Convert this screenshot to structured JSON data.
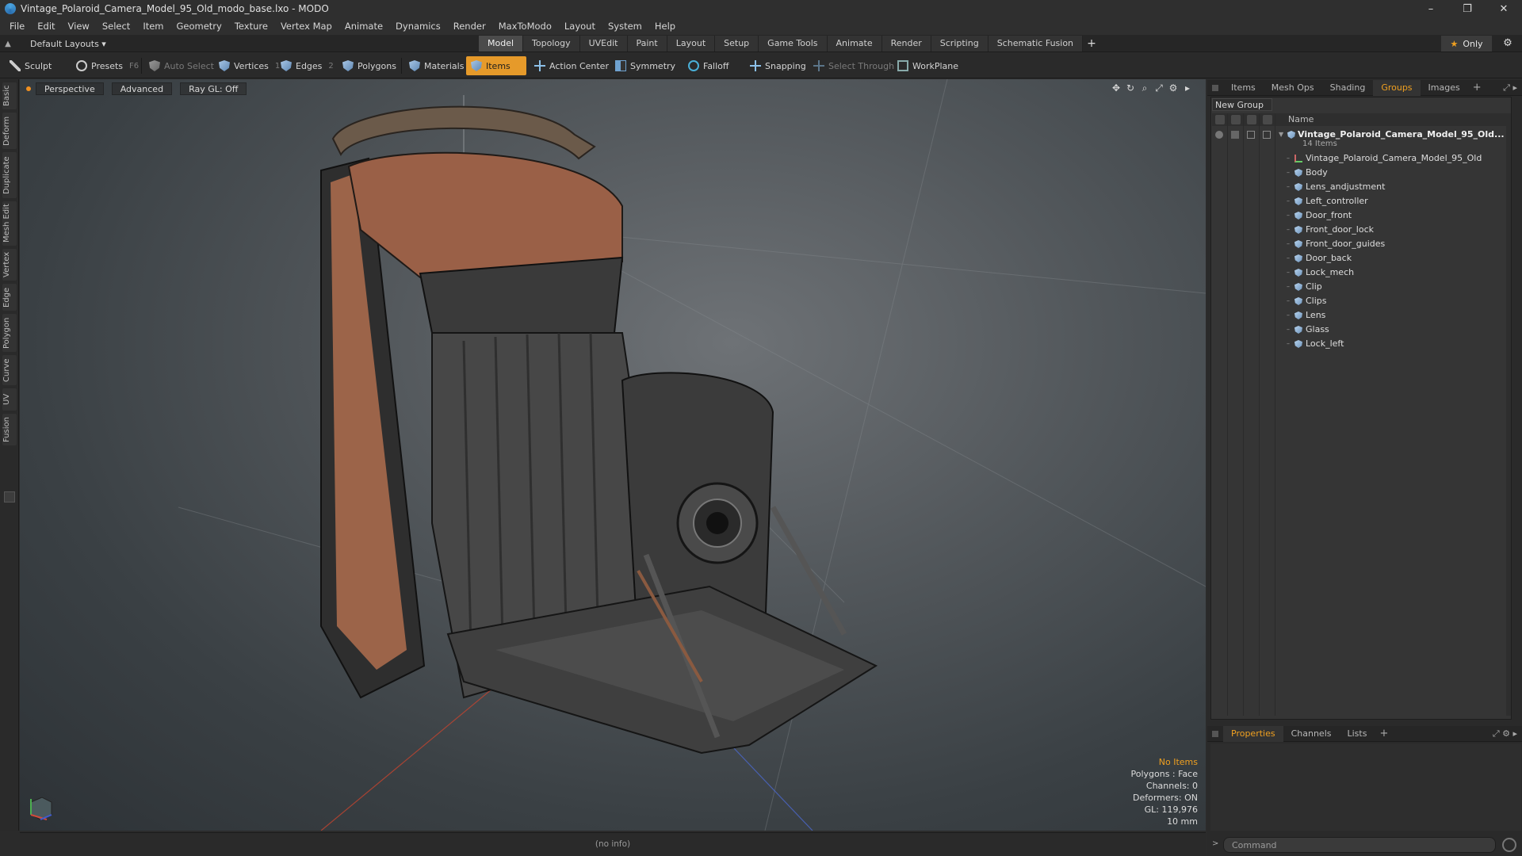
{
  "window": {
    "title": "Vintage_Polaroid_Camera_Model_95_Old_modo_base.lxo - MODO",
    "controls": [
      "–",
      "❐",
      "✕"
    ]
  },
  "menu": [
    "File",
    "Edit",
    "View",
    "Select",
    "Item",
    "Geometry",
    "Texture",
    "Vertex Map",
    "Animate",
    "Dynamics",
    "Render",
    "MaxToModo",
    "Layout",
    "System",
    "Help"
  ],
  "layout": {
    "current": "Default Layouts ▾",
    "tabs": [
      "Model",
      "Topology",
      "UVEdit",
      "Paint",
      "Layout",
      "Setup",
      "Game Tools",
      "Animate",
      "Render",
      "Scripting",
      "Schematic Fusion"
    ],
    "active_tab": "Model",
    "only_label": "Only"
  },
  "toolbar": {
    "sculpt": "Sculpt",
    "presets": "Presets",
    "presets_key": "F6",
    "auto_select": "Auto Select",
    "vertices": "Vertices",
    "vertices_key": "1",
    "edges": "Edges",
    "edges_key": "2",
    "polygons": "Polygons",
    "materials": "Materials",
    "items": "Items",
    "action_center": "Action Center",
    "symmetry": "Symmetry",
    "falloff": "Falloff",
    "snapping": "Snapping",
    "select_through": "Select Through",
    "workplane": "WorkPlane"
  },
  "left_tabs": [
    "Basic",
    "Deform",
    "Duplicate",
    "Mesh Edit",
    "Vertex",
    "Edge",
    "Polygon",
    "Curve",
    "UV",
    "Fusion"
  ],
  "viewport": {
    "perspective": "Perspective",
    "advanced": "Advanced",
    "raygl": "Ray GL: Off",
    "info": {
      "no_items": "No Items",
      "polygons": "Polygons : Face",
      "channels": "Channels: 0",
      "deformers": "Deformers: ON",
      "gl": "GL: 119,976",
      "scale": "10 mm"
    }
  },
  "status": {
    "info": "(no info)"
  },
  "panel_top": {
    "tabs": [
      "Items",
      "Mesh Ops",
      "Shading",
      "Groups",
      "Images"
    ],
    "active": "Groups",
    "new_group": "New Group",
    "col_name": "Name",
    "root": {
      "name": "Vintage_Polaroid_Camera_Model_95_Old...",
      "count": "14 Items"
    },
    "children": [
      {
        "name": "Vintage_Polaroid_Camera_Model_95_Old",
        "type": "locator"
      },
      {
        "name": "Body",
        "type": "mesh"
      },
      {
        "name": "Lens_andjustment",
        "type": "mesh"
      },
      {
        "name": "Left_controller",
        "type": "mesh"
      },
      {
        "name": "Door_front",
        "type": "mesh"
      },
      {
        "name": "Front_door_lock",
        "type": "mesh"
      },
      {
        "name": "Front_door_guides",
        "type": "mesh"
      },
      {
        "name": "Door_back",
        "type": "mesh"
      },
      {
        "name": "Lock_mech",
        "type": "mesh"
      },
      {
        "name": "Clip",
        "type": "mesh"
      },
      {
        "name": "Clips",
        "type": "mesh"
      },
      {
        "name": "Lens",
        "type": "mesh"
      },
      {
        "name": "Glass",
        "type": "mesh"
      },
      {
        "name": "Lock_left",
        "type": "mesh"
      }
    ]
  },
  "panel_bottom": {
    "tabs": [
      "Properties",
      "Channels",
      "Lists"
    ],
    "active": "Properties"
  },
  "command": {
    "prompt": ">",
    "placeholder": "Command"
  },
  "colors": {
    "accent": "#f0a020",
    "active_tool": "#e69a2a"
  }
}
